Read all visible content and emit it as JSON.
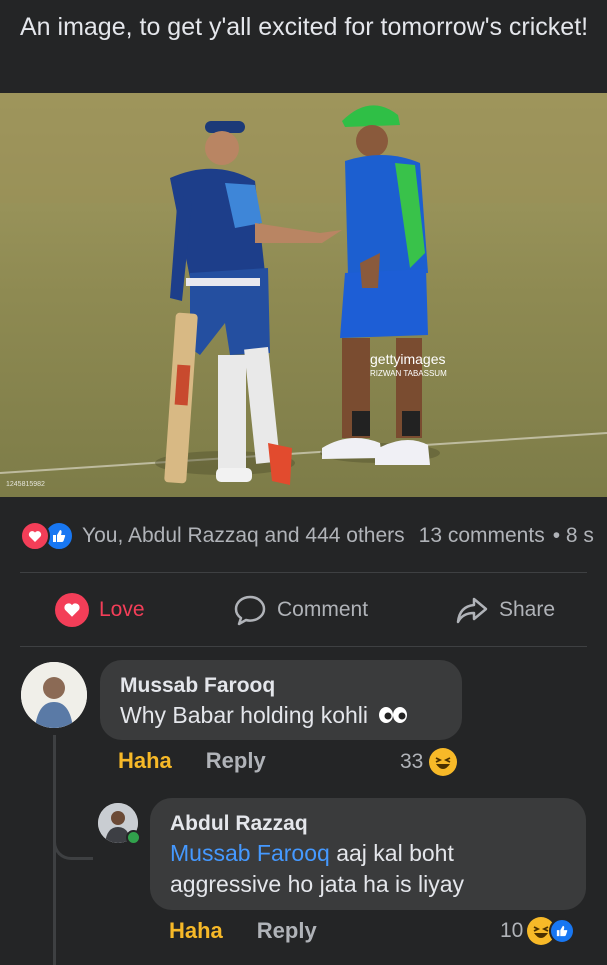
{
  "post": {
    "caption": "An image, to get y'all excited for tomorrow's cricket!",
    "photo_credit": "gettyimages",
    "photo_credit_sub": "RIZWAN TABASSUM",
    "photo_id": "1245815982"
  },
  "stats": {
    "reactions_text": "You, Abdul Razzaq and 444 others",
    "comments_text": "13 comments",
    "shares_text": "• 8 s"
  },
  "actions": {
    "love_label": "Love",
    "comment_label": "Comment",
    "share_label": "Share"
  },
  "comments": [
    {
      "author": "Mussab Farooq",
      "text": "Why Babar holding kohli",
      "reaction_label": "Haha",
      "reply_label": "Reply",
      "reaction_count": "33"
    }
  ],
  "reply": {
    "author": "Abdul Razzaq",
    "mention": "Mussab Farooq",
    "text": " aaj kal boht aggressive ho jata ha is liyay",
    "reaction_label": "Haha",
    "reply_label": "Reply",
    "reaction_count": "10"
  },
  "colors": {
    "background": "#242526",
    "bubble": "#3a3b3c",
    "love": "#f33e58",
    "like": "#1877f2",
    "haha": "#f7b928",
    "mention": "#4599ff"
  }
}
